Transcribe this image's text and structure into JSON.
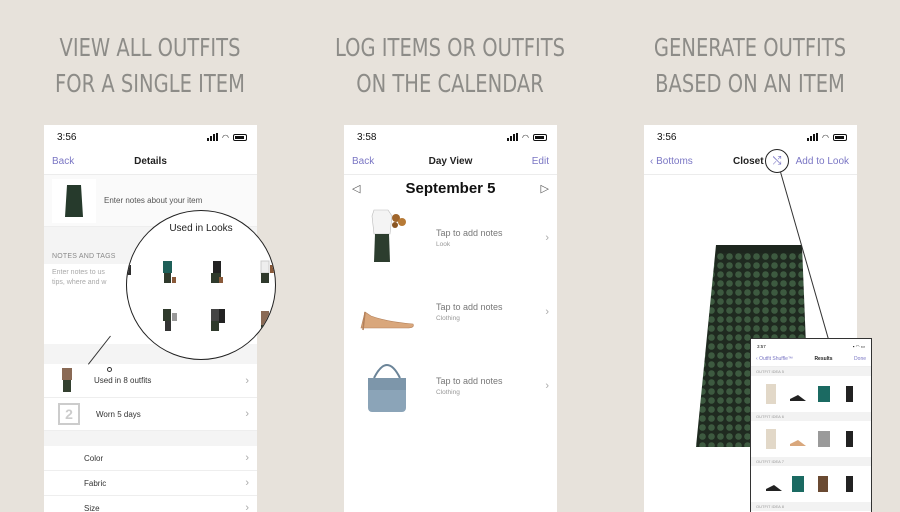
{
  "headlines": [
    {
      "line1": "VIEW ALL OUTFITS",
      "line2": "FOR A SINGLE ITEM"
    },
    {
      "line1": "LOG ITEMS OR OUTFITS",
      "line2": "ON THE CALENDAR"
    },
    {
      "line1": "GENERATE OUTFITS",
      "line2": "BASED ON AN ITEM"
    }
  ],
  "colors": {
    "background": "#e7e2db",
    "headline": "#8d8c88",
    "accent": "#7a76c4"
  },
  "phone1": {
    "time": "3:56",
    "nav": {
      "back": "Back",
      "title": "Details"
    },
    "notes_placeholder": "Enter notes about your item",
    "section_label": "NOTES AND TAGS",
    "notes_hint": "Enter notes to us",
    "notes_hint2": "tips, where and w",
    "magnifier_title": "Used in Looks",
    "used_in": "Used in 8 outfits",
    "worn_number": "2",
    "worn": "Worn 5 days",
    "properties": [
      "Color",
      "Fabric",
      "Size"
    ]
  },
  "phone2": {
    "time": "3:58",
    "nav": {
      "back": "Back",
      "title": "Day View",
      "edit": "Edit"
    },
    "date": "September 5",
    "entries": [
      {
        "tap": "Tap to add notes",
        "kind": "Look",
        "icon": "outfit-look"
      },
      {
        "tap": "Tap to add notes",
        "kind": "Clothing",
        "icon": "nude-heels"
      },
      {
        "tap": "Tap to add notes",
        "kind": "Clothing",
        "icon": "blue-handbag"
      }
    ]
  },
  "phone3": {
    "time": "3:56",
    "nav": {
      "back": "Bottoms",
      "title": "Closet",
      "add": "Add to Look"
    },
    "shuffle_icon": "shuffle-icon",
    "mini": {
      "time": "3:57",
      "back": "Outfit Shuffle™",
      "title": "Results",
      "done": "Done",
      "ideas": [
        "OUTFIT IDEA 5",
        "OUTFIT IDEA 6",
        "OUTFIT IDEA 7",
        "OUTFIT IDEA 8"
      ]
    }
  }
}
